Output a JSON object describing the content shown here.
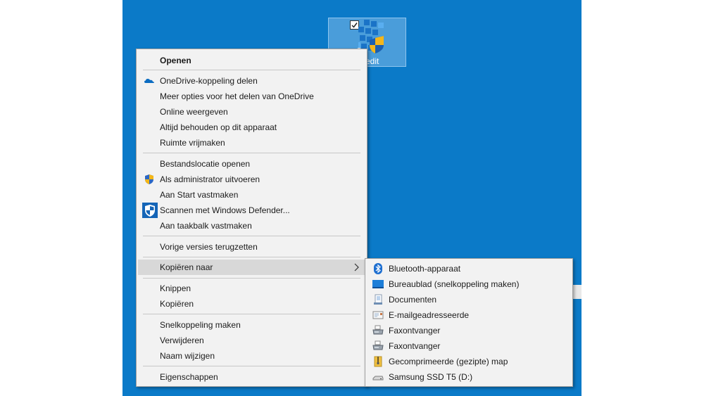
{
  "desktop_icon": {
    "label": "edit"
  },
  "main_menu": {
    "open": "Openen",
    "onedrive_share": "OneDrive-koppeling delen",
    "onedrive_more": "Meer opties voor het delen van OneDrive",
    "view_online": "Online weergeven",
    "keep_on_device": "Altijd behouden op dit apparaat",
    "free_space": "Ruimte vrijmaken",
    "open_location": "Bestandslocatie openen",
    "run_as_admin": "Als administrator uitvoeren",
    "pin_start": "Aan Start vastmaken",
    "scan_defender": "Scannen met Windows Defender...",
    "pin_taskbar": "Aan taakbalk vastmaken",
    "restore_versions": "Vorige versies terugzetten",
    "send_to": "Kopiëren naar",
    "cut": "Knippen",
    "copy": "Kopiëren",
    "create_shortcut": "Snelkoppeling maken",
    "delete": "Verwijderen",
    "rename": "Naam wijzigen",
    "properties": "Eigenschappen"
  },
  "sub_menu": {
    "bluetooth": "Bluetooth-apparaat",
    "desktop": "Bureaublad (snelkoppeling maken)",
    "documents": "Documenten",
    "mail": "E-mailgeadresseerde",
    "fax1": "Faxontvanger",
    "fax2": "Faxontvanger",
    "zip": "Gecomprimeerde (gezipte) map",
    "drive": "Samsung SSD T5 (D:)"
  },
  "colors": {
    "desktop": "#0b7ac8",
    "menu_bg": "#f2f2f2",
    "hover": "#d8d8d8"
  }
}
